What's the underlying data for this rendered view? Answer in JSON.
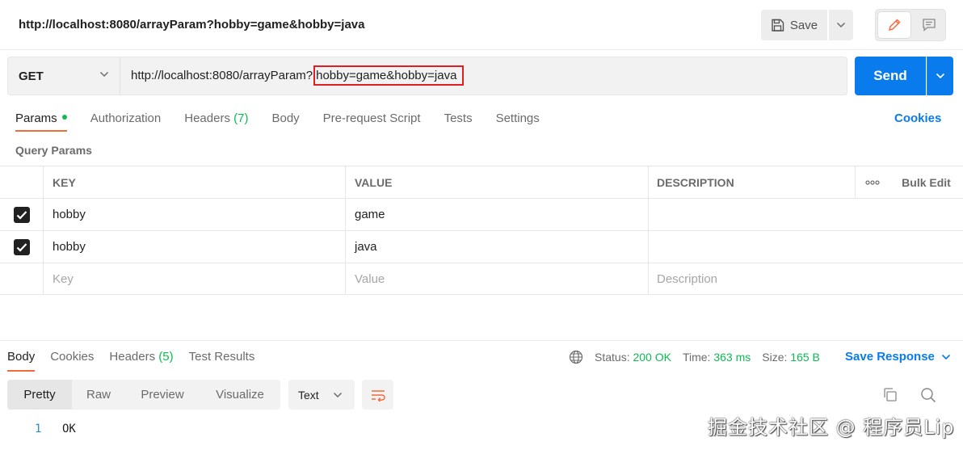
{
  "request": {
    "title": "http://localhost:8080/arrayParam?hobby=game&hobby=java",
    "method": "GET",
    "url_base": "http://localhost:8080/arrayParam?",
    "url_query": "hobby=game&hobby=java",
    "save_label": "Save",
    "send_label": "Send"
  },
  "tabs": {
    "params": "Params",
    "authorization": "Authorization",
    "headers": "Headers",
    "headers_count": "(7)",
    "body": "Body",
    "prerequest": "Pre-request Script",
    "tests": "Tests",
    "settings": "Settings",
    "cookies": "Cookies"
  },
  "query_params": {
    "title": "Query Params",
    "columns": {
      "key": "KEY",
      "value": "VALUE",
      "description": "DESCRIPTION",
      "bulk_edit": "Bulk Edit"
    },
    "rows": [
      {
        "key": "hobby",
        "value": "game",
        "description": "",
        "checked": true
      },
      {
        "key": "hobby",
        "value": "java",
        "description": "",
        "checked": true
      }
    ],
    "placeholders": {
      "key": "Key",
      "value": "Value",
      "description": "Description"
    }
  },
  "response": {
    "tabs": {
      "body": "Body",
      "cookies": "Cookies",
      "headers": "Headers",
      "headers_count": "(5)",
      "test_results": "Test Results"
    },
    "status_label": "Status:",
    "status_value": "200 OK",
    "time_label": "Time:",
    "time_value": "363 ms",
    "size_label": "Size:",
    "size_value": "165 B",
    "save_response": "Save Response",
    "views": [
      "Pretty",
      "Raw",
      "Preview",
      "Visualize"
    ],
    "format": "Text",
    "lines": [
      {
        "no": "1",
        "text": "OK"
      }
    ]
  },
  "watermark": "掘金技术社区 @ 程序员Lip",
  "colors": {
    "accent_blue": "#097bed",
    "active_tab": "#f26b3a",
    "success": "#0cbb52",
    "highlight_box": "#e02020"
  }
}
